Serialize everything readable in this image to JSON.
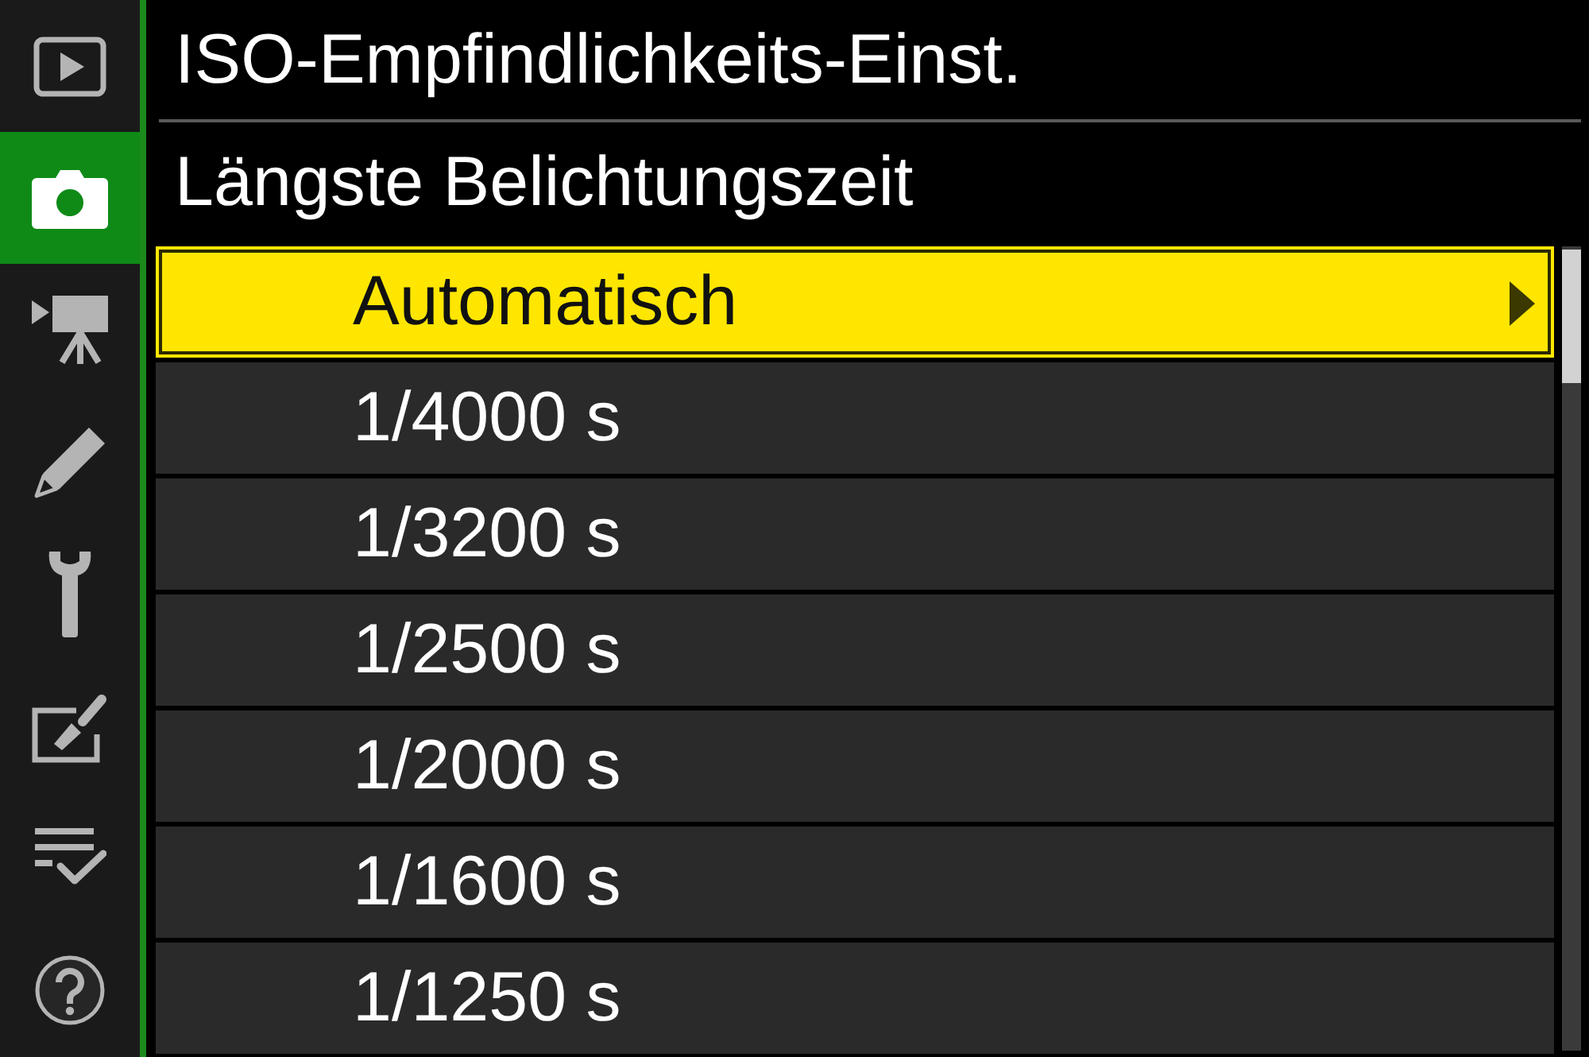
{
  "sidebar": {
    "items": [
      {
        "kind": "playback",
        "selected": false
      },
      {
        "kind": "photo",
        "selected": true
      },
      {
        "kind": "movie",
        "selected": false
      },
      {
        "kind": "custom",
        "selected": false
      },
      {
        "kind": "setup",
        "selected": false
      },
      {
        "kind": "retouch",
        "selected": false
      },
      {
        "kind": "mymenu",
        "selected": false
      },
      {
        "kind": "help",
        "selected": false
      }
    ]
  },
  "header": {
    "title": "ISO-Empfindlichkeits-Einst.",
    "subtitle": "Längste Belichtungszeit"
  },
  "options": [
    {
      "label": "Automatisch",
      "selected": true,
      "submenu": true
    },
    {
      "label": "1/4000 s",
      "selected": false,
      "submenu": false
    },
    {
      "label": "1/3200 s",
      "selected": false,
      "submenu": false
    },
    {
      "label": "1/2500 s",
      "selected": false,
      "submenu": false
    },
    {
      "label": "1/2000 s",
      "selected": false,
      "submenu": false
    },
    {
      "label": "1/1600 s",
      "selected": false,
      "submenu": false
    },
    {
      "label": "1/1250 s",
      "selected": false,
      "submenu": false
    }
  ]
}
